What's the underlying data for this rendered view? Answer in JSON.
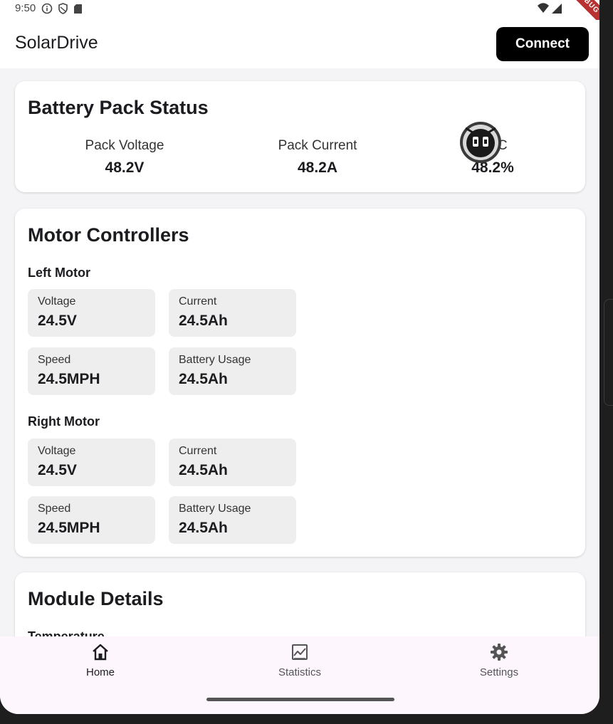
{
  "status_bar": {
    "time": "9:50",
    "debug_label": "DEBUG"
  },
  "app_bar": {
    "title": "SolarDrive",
    "connect_label": "Connect"
  },
  "battery": {
    "title": "Battery Pack Status",
    "stats": [
      {
        "label": "Pack Voltage",
        "value": "48.2V"
      },
      {
        "label": "Pack Current",
        "value": "48.2A"
      },
      {
        "label": "SOC",
        "value": "48.2%"
      }
    ]
  },
  "motors": {
    "title": "Motor Controllers",
    "left": {
      "heading": "Left Motor",
      "tiles": [
        {
          "label": "Voltage",
          "value": "24.5V"
        },
        {
          "label": "Current",
          "value": "24.5Ah"
        },
        {
          "label": "Speed",
          "value": "24.5MPH"
        },
        {
          "label": "Battery Usage",
          "value": "24.5Ah"
        }
      ]
    },
    "right": {
      "heading": "Right Motor",
      "tiles": [
        {
          "label": "Voltage",
          "value": "24.5V"
        },
        {
          "label": "Current",
          "value": "24.5Ah"
        },
        {
          "label": "Speed",
          "value": "24.5MPH"
        },
        {
          "label": "Battery Usage",
          "value": "24.5Ah"
        }
      ]
    }
  },
  "module": {
    "title": "Module Details",
    "subtitle": "Temperature"
  },
  "nav": {
    "items": [
      {
        "label": "Home",
        "icon": "home-icon",
        "active": true
      },
      {
        "label": "Statistics",
        "icon": "chart-icon",
        "active": false
      },
      {
        "label": "Settings",
        "icon": "gear-icon",
        "active": false
      }
    ]
  },
  "colors": {
    "accent": "#000000",
    "nav_bg": "#fdf7fd",
    "tile_bg": "#eeeeee",
    "debug_banner": "#b83232"
  }
}
